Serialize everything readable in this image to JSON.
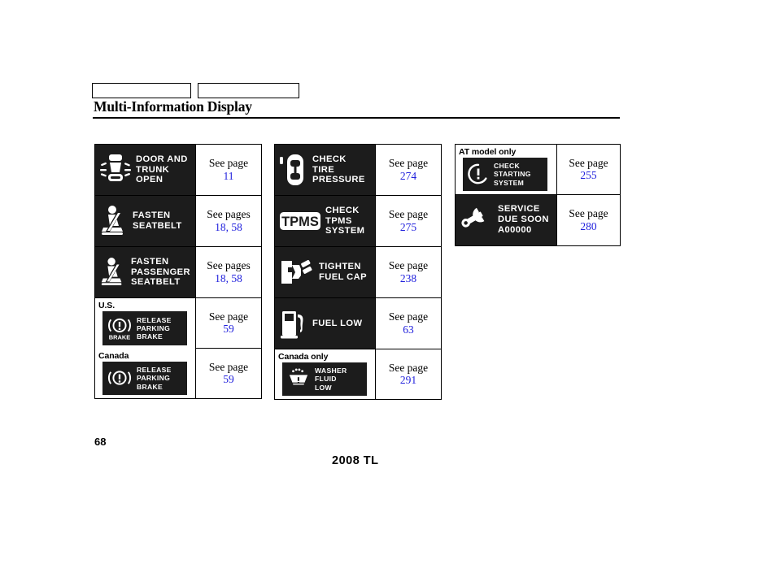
{
  "header": {
    "tab_left_label": "",
    "tab_right_label": "",
    "title": "Multi-Information Display"
  },
  "footer": {
    "page_number": "68",
    "model_year": "2008  TL"
  },
  "labels": {
    "see_page": "See page",
    "see_pages": "See pages"
  },
  "colors": {
    "page_link": "#2222dd",
    "badge_background": "#1c1c1c",
    "badge_text": "#ffffff"
  },
  "columns": [
    {
      "id": "column-1",
      "rows": [
        {
          "icon": "door-and-trunk-open-icon",
          "message": "DOOR AND\nTRUNK\nOPEN",
          "see_label": "See page",
          "pages": "11"
        },
        {
          "icon": "fasten-seatbelt-icon",
          "message": "FASTEN\nSEATBELT",
          "see_label": "See pages",
          "pages": "18, 58"
        },
        {
          "icon": "fasten-passenger-seatbelt-icon",
          "message": "FASTEN\nPASSENGER\nSEATBELT",
          "see_label": "See pages",
          "pages": "18, 58"
        }
      ],
      "region_group": {
        "variants": [
          {
            "region_label": "U.S.",
            "icon": "release-parking-brake-us-icon",
            "message": "RELEASE\nPARKING\nBRAKE",
            "brake_word": "BRAKE",
            "see_label": "See page",
            "pages": "59"
          },
          {
            "region_label": "Canada",
            "icon": "release-parking-brake-canada-icon",
            "message": "RELEASE\nPARKING\nBRAKE",
            "see_label": "See page",
            "pages": "59"
          }
        ]
      }
    },
    {
      "id": "column-2",
      "rows": [
        {
          "icon": "check-tire-pressure-icon",
          "message": "CHECK\nTIRE\nPRESSURE",
          "see_label": "See page",
          "pages": "274"
        },
        {
          "icon": "tpms-icon",
          "icon_text": "TPMS",
          "message": "CHECK\nTPMS\nSYSTEM",
          "see_label": "See page",
          "pages": "275"
        },
        {
          "icon": "tighten-fuel-cap-icon",
          "message": "TIGHTEN\nFUEL CAP",
          "see_label": "See page",
          "pages": "238"
        },
        {
          "icon": "fuel-low-icon",
          "message": "FUEL LOW",
          "see_label": "See page",
          "pages": "63"
        }
      ],
      "region_row": {
        "region_label": "Canada only",
        "icon": "washer-fluid-low-icon",
        "message": "WASHER\nFLUID\nLOW",
        "see_label": "See page",
        "pages": "291"
      }
    },
    {
      "id": "column-3",
      "region_row": {
        "region_label": "AT model only",
        "icon": "check-starting-system-icon",
        "message": "CHECK\nSTARTING\nSYSTEM",
        "see_label": "See page",
        "pages": "255"
      },
      "rows": [
        {
          "icon": "service-due-soon-icon",
          "message": "SERVICE\nDUE SOON\nA00000",
          "see_label": "See page",
          "pages": "280"
        }
      ]
    }
  ]
}
